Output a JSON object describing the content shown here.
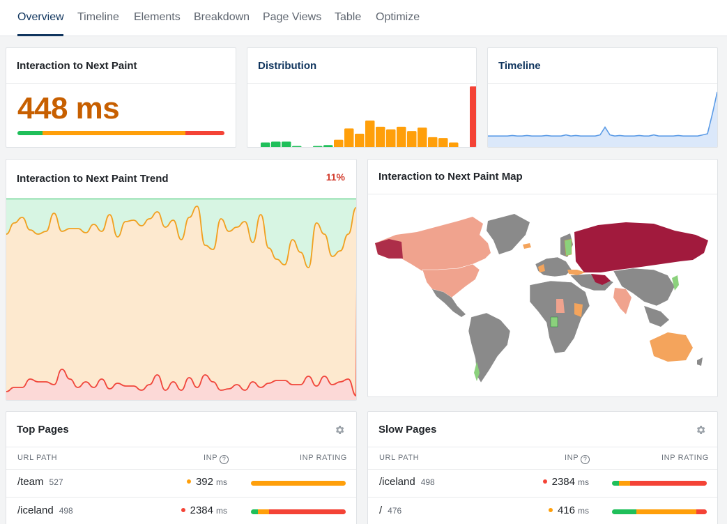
{
  "tabs": [
    {
      "label": "Overview",
      "active": true
    },
    {
      "label": "Timeline"
    },
    {
      "label": "Elements"
    },
    {
      "label": "Breakdown"
    },
    {
      "label": "Page Views"
    },
    {
      "label": "Table"
    },
    {
      "label": "Optimize"
    }
  ],
  "metric_card": {
    "title": "Interaction to Next Paint",
    "value": "448 ms",
    "score_split": {
      "good": 0.12,
      "needs_improvement": 0.69,
      "poor": 0.19
    }
  },
  "distribution_card": {
    "title": "Distribution",
    "bars": [
      {
        "v": 6,
        "rating": "good"
      },
      {
        "v": 7,
        "rating": "good"
      },
      {
        "v": 7,
        "rating": "good"
      },
      {
        "v": 2,
        "rating": "good"
      },
      {
        "v": 0,
        "rating": "good"
      },
      {
        "v": 2,
        "rating": "good"
      },
      {
        "v": 3,
        "rating": "good"
      },
      {
        "v": 9,
        "rating": "ni"
      },
      {
        "v": 22,
        "rating": "ni"
      },
      {
        "v": 16,
        "rating": "ni"
      },
      {
        "v": 31,
        "rating": "ni"
      },
      {
        "v": 24,
        "rating": "ni"
      },
      {
        "v": 21,
        "rating": "ni"
      },
      {
        "v": 24,
        "rating": "ni"
      },
      {
        "v": 19,
        "rating": "ni"
      },
      {
        "v": 23,
        "rating": "ni"
      },
      {
        "v": 12,
        "rating": "ni"
      },
      {
        "v": 11,
        "rating": "ni"
      },
      {
        "v": 6,
        "rating": "ni"
      },
      {
        "v": 0,
        "rating": "ni"
      },
      {
        "v": 70,
        "rating": "poor"
      }
    ]
  },
  "timeline_card": {
    "title": "Timeline",
    "values": [
      10,
      10,
      10,
      10,
      10,
      10.5,
      10,
      10,
      10.5,
      10,
      10,
      10,
      10.5,
      10,
      10,
      10,
      11,
      10,
      10.5,
      10,
      10,
      10,
      10,
      11,
      18,
      11,
      10,
      10.5,
      10,
      10,
      10,
      10.5,
      10,
      10,
      11,
      10,
      10,
      10,
      10,
      10.5,
      10,
      10,
      10,
      10,
      11,
      12,
      30,
      50
    ]
  },
  "trend_card": {
    "title": "Interaction to Next Paint Trend",
    "percent": "11%",
    "upper_series": [
      24,
      16,
      12,
      21,
      24,
      22,
      9,
      22,
      20,
      20,
      23,
      17,
      22,
      10,
      26,
      15,
      14,
      18,
      13,
      8,
      19,
      14,
      28,
      12,
      4,
      32,
      35,
      13,
      22,
      19,
      15,
      30,
      10,
      34,
      42,
      46,
      28,
      37,
      48,
      16,
      24,
      40,
      36,
      24,
      5
    ],
    "lower_series": [
      5,
      8,
      8,
      14,
      12,
      12,
      10,
      21,
      14,
      8,
      12,
      8,
      14,
      7,
      11,
      9,
      9,
      6,
      10,
      17,
      6,
      12,
      6,
      15,
      8,
      17,
      12,
      6,
      7,
      10,
      6,
      12,
      8,
      11,
      13,
      13,
      10,
      10,
      16,
      9,
      16,
      10,
      12,
      14,
      2
    ]
  },
  "map_card": {
    "title": "Interaction to Next Paint Map",
    "colors": {
      "no_data": "#8a8a8a",
      "good": "#8bd17c",
      "moderate": "#f4a45c",
      "slow": "#f0a38e",
      "critical": "#a11a3d"
    }
  },
  "top_pages": {
    "title": "Top Pages",
    "columns": [
      "URL PATH",
      "INP",
      "INP RATING"
    ],
    "rows": [
      {
        "path": "/team",
        "count": "527",
        "value": "392",
        "unit": "ms",
        "status": "#ff9f0a",
        "split": [
          0.0,
          1.0,
          0.0
        ]
      },
      {
        "path": "/iceland",
        "count": "498",
        "value": "2384",
        "unit": "ms",
        "status": "#f44336",
        "split": [
          0.07,
          0.12,
          0.81
        ]
      }
    ]
  },
  "slow_pages": {
    "title": "Slow Pages",
    "columns": [
      "URL PATH",
      "INP",
      "INP RATING"
    ],
    "rows": [
      {
        "path": "/iceland",
        "count": "498",
        "value": "2384",
        "unit": "ms",
        "status": "#f44336",
        "split": [
          0.07,
          0.12,
          0.81
        ]
      },
      {
        "path": "/",
        "count": "476",
        "value": "416",
        "unit": "ms",
        "status": "#ff9f0a",
        "split": [
          0.26,
          0.63,
          0.11
        ]
      }
    ]
  },
  "palette": {
    "good": "#1fbf5a",
    "ni": "#ff9f0a",
    "poor": "#f44336",
    "timeline": "#5b9be6",
    "accent": "#10355e"
  }
}
